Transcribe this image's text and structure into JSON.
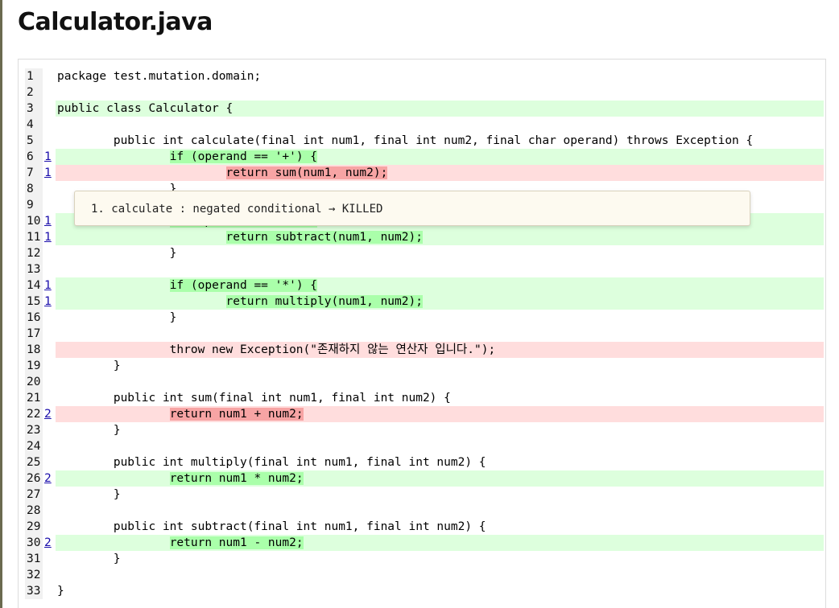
{
  "page": {
    "title": "Calculator.java"
  },
  "tooltip": {
    "text": "1. calculate : negated conditional → KILLED"
  },
  "lines": [
    {
      "no": "1",
      "mutants": "",
      "status": "none",
      "code": "package test.mutation.domain;"
    },
    {
      "no": "2",
      "mutants": "",
      "status": "none",
      "code": ""
    },
    {
      "no": "3",
      "mutants": "",
      "status": "plain-covered",
      "code": "public class Calculator {"
    },
    {
      "no": "4",
      "mutants": "",
      "status": "none",
      "code": ""
    },
    {
      "no": "5",
      "mutants": "",
      "status": "none",
      "code": "\tpublic int calculate(final int num1, final int num2, final char operand) throws Exception {"
    },
    {
      "no": "6",
      "mutants": "1",
      "status": "covered",
      "code": "\t\tif (operand == '+') {"
    },
    {
      "no": "7",
      "mutants": "1",
      "status": "uncovered",
      "code": "\t\t\treturn sum(num1, num2);"
    },
    {
      "no": "8",
      "mutants": "",
      "status": "none",
      "code": "\t\t}"
    },
    {
      "no": "9",
      "mutants": "",
      "status": "none",
      "code": ""
    },
    {
      "no": "10",
      "mutants": "1",
      "status": "covered",
      "code": "\t\tif (operand == '-') {"
    },
    {
      "no": "11",
      "mutants": "1",
      "status": "covered",
      "code": "\t\t\treturn subtract(num1, num2);"
    },
    {
      "no": "12",
      "mutants": "",
      "status": "none",
      "code": "\t\t}"
    },
    {
      "no": "13",
      "mutants": "",
      "status": "none",
      "code": ""
    },
    {
      "no": "14",
      "mutants": "1",
      "status": "covered",
      "code": "\t\tif (operand == '*') {"
    },
    {
      "no": "15",
      "mutants": "1",
      "status": "covered",
      "code": "\t\t\treturn multiply(num1, num2);"
    },
    {
      "no": "16",
      "mutants": "",
      "status": "none",
      "code": "\t\t}"
    },
    {
      "no": "17",
      "mutants": "",
      "status": "none",
      "code": ""
    },
    {
      "no": "18",
      "mutants": "",
      "status": "plain-uncovered",
      "code": "\t\tthrow new Exception(\"존재하지 않는 연산자 입니다.\");"
    },
    {
      "no": "19",
      "mutants": "",
      "status": "none",
      "code": "\t}"
    },
    {
      "no": "20",
      "mutants": "",
      "status": "none",
      "code": ""
    },
    {
      "no": "21",
      "mutants": "",
      "status": "none",
      "code": "\tpublic int sum(final int num1, final int num2) {"
    },
    {
      "no": "22",
      "mutants": "2",
      "status": "uncovered",
      "code": "\t\treturn num1 + num2;"
    },
    {
      "no": "23",
      "mutants": "",
      "status": "none",
      "code": "\t}"
    },
    {
      "no": "24",
      "mutants": "",
      "status": "none",
      "code": ""
    },
    {
      "no": "25",
      "mutants": "",
      "status": "none",
      "code": "\tpublic int multiply(final int num1, final int num2) {"
    },
    {
      "no": "26",
      "mutants": "2",
      "status": "covered",
      "code": "\t\treturn num1 * num2;"
    },
    {
      "no": "27",
      "mutants": "",
      "status": "none",
      "code": "\t}"
    },
    {
      "no": "28",
      "mutants": "",
      "status": "none",
      "code": ""
    },
    {
      "no": "29",
      "mutants": "",
      "status": "none",
      "code": "\tpublic int subtract(final int num1, final int num2) {"
    },
    {
      "no": "30",
      "mutants": "2",
      "status": "covered",
      "code": "\t\treturn num1 - num2;"
    },
    {
      "no": "31",
      "mutants": "",
      "status": "none",
      "code": "\t}"
    },
    {
      "no": "32",
      "mutants": "",
      "status": "none",
      "code": ""
    },
    {
      "no": "33",
      "mutants": "",
      "status": "none",
      "code": "}"
    }
  ]
}
